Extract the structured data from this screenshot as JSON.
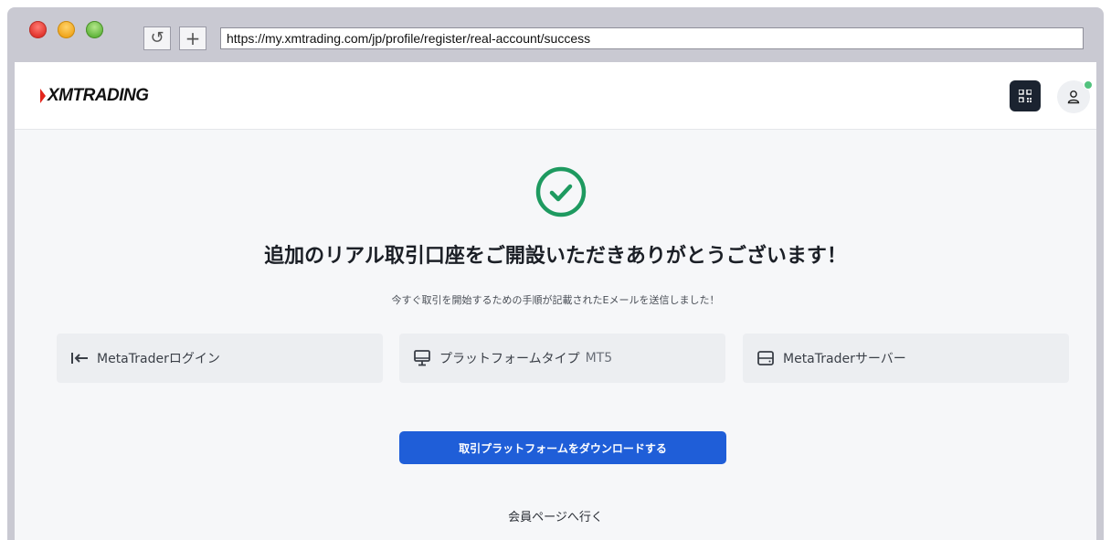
{
  "browser": {
    "url": "https://my.xmtrading.com/jp/profile/register/real-account/success",
    "reload_glyph": "↺",
    "newtab_glyph": "+"
  },
  "header": {
    "logo_text": "XMTRADING",
    "brand_color": "#e3261c",
    "qr_icon": "qr-code-icon",
    "user_icon": "user-icon"
  },
  "success": {
    "icon": "check-circle-icon",
    "accent": "#1e9a60",
    "title": "追加のリアル取引口座をご開設いただきありがとうございます！",
    "subtitle": "今すぐ取引を開始するための手順が記載されたEメールを送信しました！"
  },
  "cards": [
    {
      "icon": "login-arrow-icon",
      "label": "MetaTraderログイン",
      "value": ""
    },
    {
      "icon": "monitor-icon",
      "label": "プラットフォームタイプ",
      "value": "MT5"
    },
    {
      "icon": "server-icon",
      "label": "MetaTraderサーバー",
      "value": ""
    }
  ],
  "actions": {
    "download_label": "取引プラットフォームをダウンロードする",
    "member_page_label": "会員ページへ行く",
    "button_color": "#1f5ed8"
  }
}
